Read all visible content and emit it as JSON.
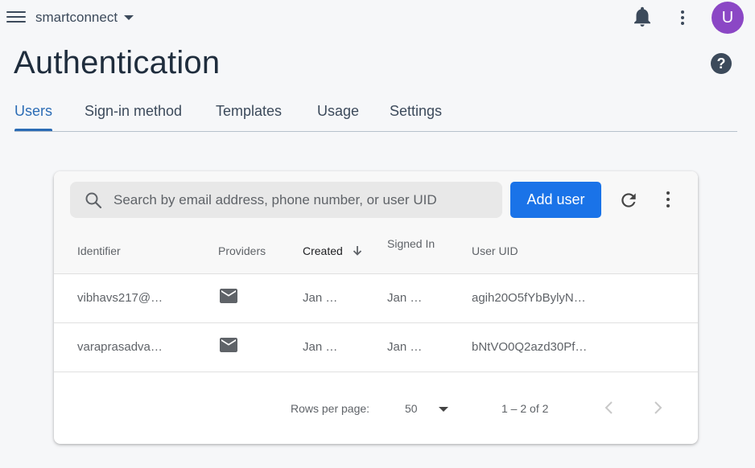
{
  "topbar": {
    "project_name": "smartconnect",
    "avatar_initial": "U"
  },
  "page": {
    "title": "Authentication",
    "help_label": "?"
  },
  "tabs": [
    {
      "label": "Users",
      "active": true
    },
    {
      "label": "Sign-in method",
      "active": false
    },
    {
      "label": "Templates",
      "active": false
    },
    {
      "label": "Usage",
      "active": false
    },
    {
      "label": "Settings",
      "active": false
    }
  ],
  "toolbar": {
    "search_placeholder": "Search by email address, phone number, or user UID",
    "add_user_label": "Add user"
  },
  "table": {
    "columns": [
      "Identifier",
      "Providers",
      "Created",
      "Signed In",
      "User UID"
    ],
    "sorted_column": "Created",
    "rows": [
      {
        "identifier": "vibhavs217@…",
        "provider_icon": "mail-icon",
        "created": "Jan …",
        "signed_in": "Jan …",
        "uid": "agih20O5fYbBylyN…"
      },
      {
        "identifier": "varaprasadva…",
        "provider_icon": "mail-icon",
        "created": "Jan …",
        "signed_in": "Jan …",
        "uid": "bNtVO0Q2azd30Pf…"
      }
    ]
  },
  "pagination": {
    "rows_per_page_label": "Rows per page:",
    "rows_per_page_value": "50",
    "range_label": "1 – 2 of 2"
  },
  "colors": {
    "accent": "#2b6cb5",
    "primary_button": "#1a73e8",
    "avatar": "#8b47c5",
    "title_text": "#1f2d3d"
  }
}
